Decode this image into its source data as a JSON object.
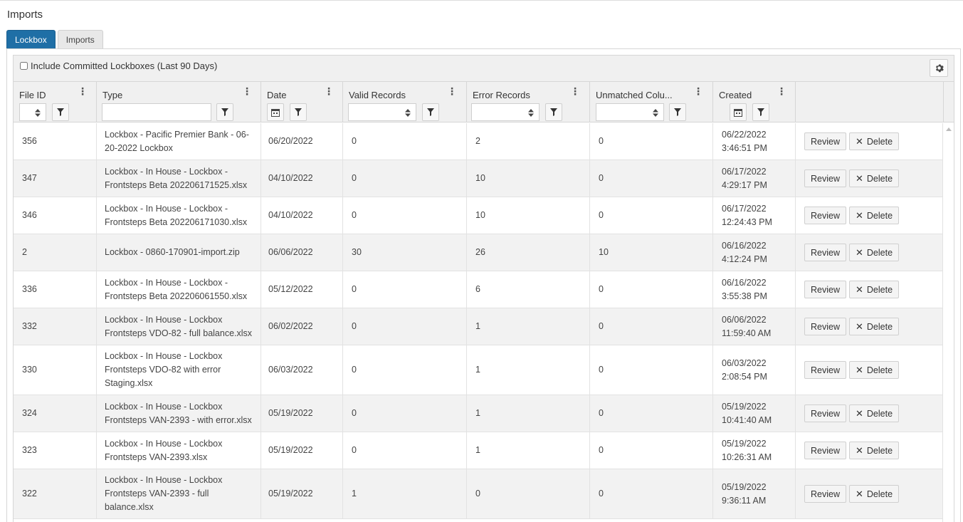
{
  "page": {
    "title": "Imports"
  },
  "tabs": [
    {
      "label": "Lockbox",
      "active": true
    },
    {
      "label": "Imports",
      "active": false
    }
  ],
  "toolbar": {
    "include_committed_label": "Include Committed Lockboxes (Last 90 Days)",
    "include_committed_checked": false
  },
  "columns": {
    "file_id": "File ID",
    "type": "Type",
    "date": "Date",
    "valid": "Valid Records",
    "error": "Error Records",
    "unmatched": "Unmatched Colu...",
    "created": "Created"
  },
  "row_actions": {
    "review": "Review",
    "delete": "Delete"
  },
  "rows": [
    {
      "id": "356",
      "type": [
        "Lockbox - Pacific Premier Bank - 06-",
        "20-2022 Lockbox"
      ],
      "date": "06/20/2022",
      "valid": "0",
      "error": "2",
      "unmatched": "0",
      "created": [
        "06/22/2022",
        "3:46:51 PM"
      ]
    },
    {
      "id": "347",
      "type": [
        "Lockbox - In House - Lockbox -",
        "Frontsteps Beta 202206171525.xlsx"
      ],
      "date": "04/10/2022",
      "valid": "0",
      "error": "10",
      "unmatched": "0",
      "created": [
        "06/17/2022",
        "4:29:17 PM"
      ]
    },
    {
      "id": "346",
      "type": [
        "Lockbox - In House - Lockbox -",
        "Frontsteps Beta 202206171030.xlsx"
      ],
      "date": "04/10/2022",
      "valid": "0",
      "error": "10",
      "unmatched": "0",
      "created": [
        "06/17/2022",
        "12:24:43 PM"
      ]
    },
    {
      "id": "2",
      "type": [
        "Lockbox - 0860-170901-import.zip"
      ],
      "date": "06/06/2022",
      "valid": "30",
      "error": "26",
      "unmatched": "10",
      "created": [
        "06/16/2022",
        "4:12:24 PM"
      ]
    },
    {
      "id": "336",
      "type": [
        "Lockbox - In House - Lockbox -",
        "Frontsteps Beta 202206061550.xlsx"
      ],
      "date": "05/12/2022",
      "valid": "0",
      "error": "6",
      "unmatched": "0",
      "created": [
        "06/16/2022",
        "3:55:38 PM"
      ]
    },
    {
      "id": "332",
      "type": [
        "Lockbox - In House - Lockbox",
        "Frontsteps VDO-82 - full balance.xlsx"
      ],
      "date": "06/02/2022",
      "valid": "0",
      "error": "1",
      "unmatched": "0",
      "created": [
        "06/06/2022",
        "11:59:40 AM"
      ]
    },
    {
      "id": "330",
      "type": [
        "Lockbox - In House - Lockbox",
        "Frontsteps VDO-82 with error",
        "Staging.xlsx"
      ],
      "date": "06/03/2022",
      "valid": "0",
      "error": "1",
      "unmatched": "0",
      "created": [
        "06/03/2022",
        "2:08:54 PM"
      ]
    },
    {
      "id": "324",
      "type": [
        "Lockbox - In House - Lockbox",
        "Frontsteps VAN-2393 - with error.xlsx"
      ],
      "date": "05/19/2022",
      "valid": "0",
      "error": "1",
      "unmatched": "0",
      "created": [
        "05/19/2022",
        "10:41:40 AM"
      ]
    },
    {
      "id": "323",
      "type": [
        "Lockbox - In House - Lockbox",
        "Frontsteps VAN-2393.xlsx"
      ],
      "date": "05/19/2022",
      "valid": "0",
      "error": "1",
      "unmatched": "0",
      "created": [
        "05/19/2022",
        "10:26:31 AM"
      ]
    },
    {
      "id": "322",
      "type": [
        "Lockbox - In House - Lockbox",
        "Frontsteps VAN-2393 - full",
        "balance.xlsx"
      ],
      "date": "05/19/2022",
      "valid": "1",
      "error": "0",
      "unmatched": "0",
      "created": [
        "05/19/2022",
        "9:36:11 AM"
      ]
    }
  ]
}
